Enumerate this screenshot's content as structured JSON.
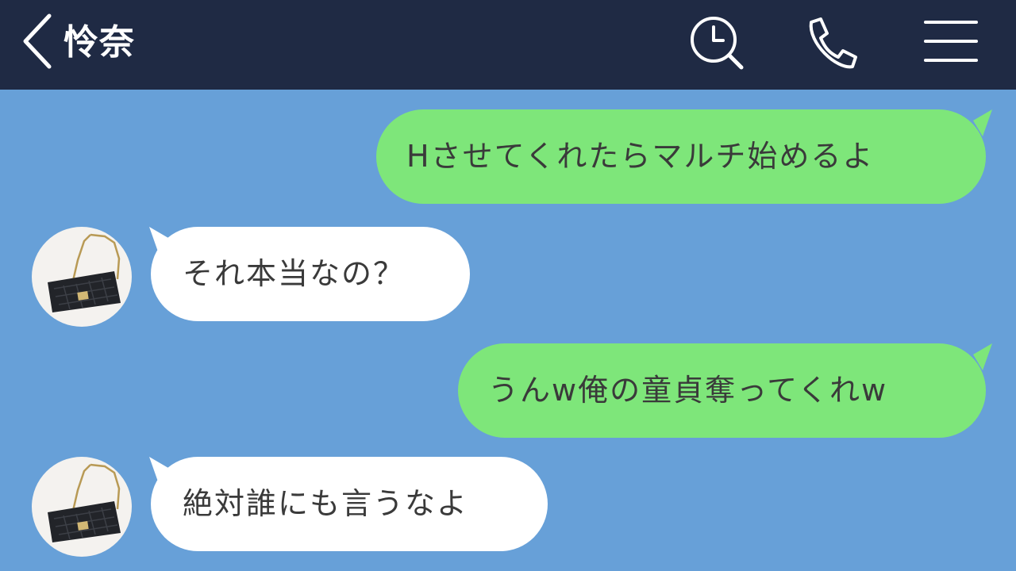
{
  "header": {
    "title": "怜奈",
    "icons": [
      "back-chevron-icon",
      "search-clock-icon",
      "phone-icon",
      "menu-icon"
    ]
  },
  "colors": {
    "header_bg": "#1f2a44",
    "chat_bg": "#67a0d8",
    "outgoing_bubble": "#7ee67a",
    "incoming_bubble": "#ffffff",
    "text": "#3a3a3a"
  },
  "messages": [
    {
      "direction": "outgoing",
      "text": "Hさせてくれたらマルチ始めるよ"
    },
    {
      "direction": "incoming",
      "text": "それ本当なの？",
      "avatar": "handbag-avatar-icon"
    },
    {
      "direction": "outgoing",
      "text": "うんw俺の童貞奪ってくれw"
    },
    {
      "direction": "incoming",
      "text": "絶対誰にも言うなよ",
      "avatar": "handbag-avatar-icon"
    }
  ]
}
